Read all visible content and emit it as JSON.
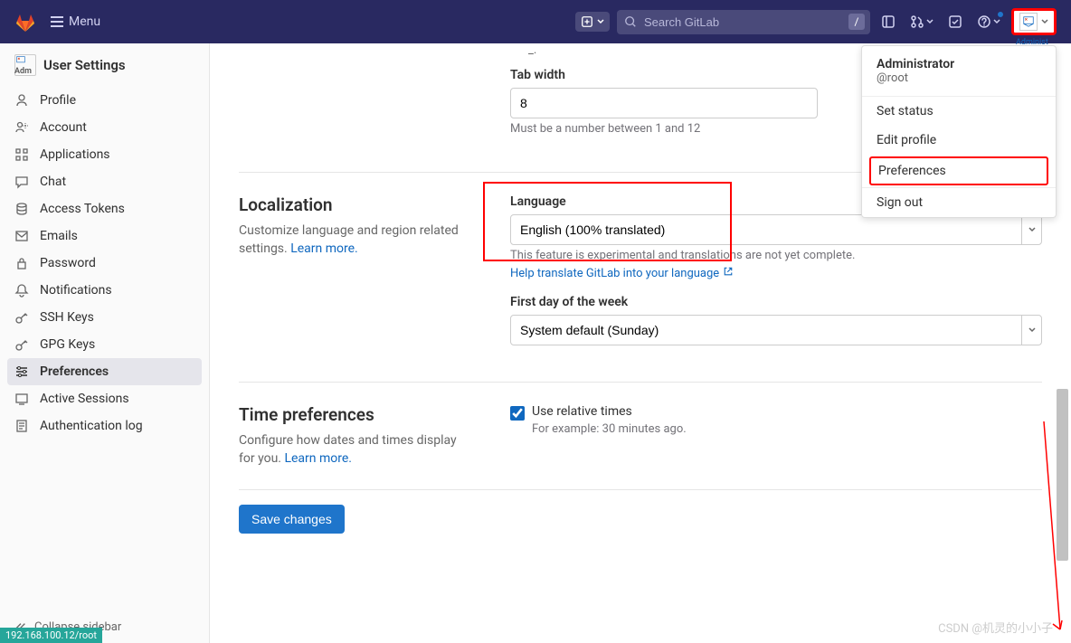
{
  "topbar": {
    "menu_label": "Menu",
    "search_placeholder": "Search GitLab",
    "slash": "/",
    "user_small": "Administ"
  },
  "sidebar": {
    "title": "User Settings",
    "avatar_text": "Adm",
    "items": [
      {
        "label": "Profile"
      },
      {
        "label": "Account"
      },
      {
        "label": "Applications"
      },
      {
        "label": "Chat"
      },
      {
        "label": "Access Tokens"
      },
      {
        "label": "Emails"
      },
      {
        "label": "Password"
      },
      {
        "label": "Notifications"
      },
      {
        "label": "SSH Keys"
      },
      {
        "label": "GPG Keys"
      },
      {
        "label": "Preferences"
      },
      {
        "label": "Active Sessions"
      },
      {
        "label": "Authentication log"
      }
    ],
    "collapse": "Collapse sidebar"
  },
  "dropdown": {
    "name": "Administrator",
    "handle": "@root",
    "items": [
      "Set status",
      "Edit profile",
      "Preferences",
      "Sign out"
    ]
  },
  "tabwidth": {
    "label": "Tab width",
    "value": "8",
    "help": "Must be a number between 1 and 12"
  },
  "localization": {
    "title": "Localization",
    "desc": "Customize language and region related settings.",
    "learn": "Learn more.",
    "lang_label": "Language",
    "lang_value": "English (100% translated)",
    "lang_help1": "This feature is experimental and translations are not yet complete.",
    "lang_help2": "Help translate GitLab into your language",
    "firstday_label": "First day of the week",
    "firstday_value": "System default (Sunday)"
  },
  "time": {
    "title": "Time preferences",
    "desc": "Configure how dates and times display for you.",
    "learn": "Learn more.",
    "check_label": "Use relative times",
    "check_help": "For example: 30 minutes ago."
  },
  "save": "Save changes",
  "status_url": "192.168.100.12/root",
  "watermark": "CSDN @机灵的小小子"
}
